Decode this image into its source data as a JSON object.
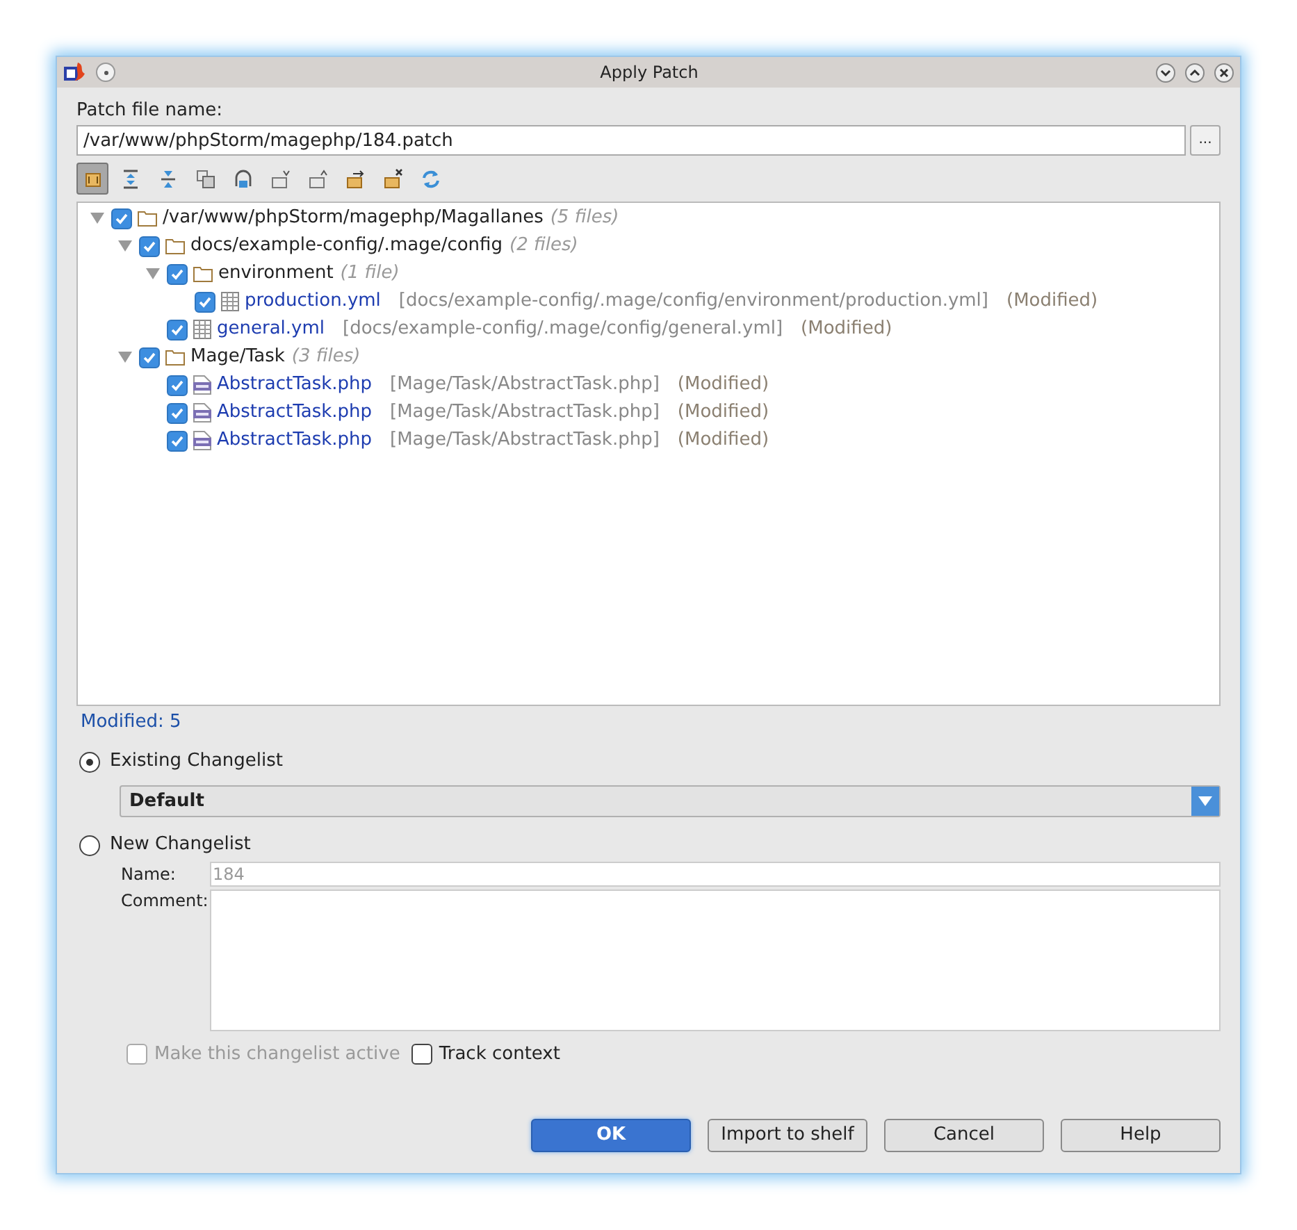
{
  "window": {
    "title": "Apply Patch"
  },
  "patch_file": {
    "label": "Patch file name:",
    "value": "/var/www/phpStorm/magephp/184.patch",
    "browse_label": "..."
  },
  "toolbar": [
    {
      "kind": "group",
      "selected": true
    },
    {
      "kind": "expand",
      "selected": false
    },
    {
      "kind": "collapse",
      "selected": false
    },
    {
      "kind": "copy",
      "selected": false
    },
    {
      "kind": "strip",
      "selected": false
    },
    {
      "kind": "down",
      "selected": false
    },
    {
      "kind": "up",
      "selected": false
    },
    {
      "kind": "export",
      "selected": false
    },
    {
      "kind": "remove",
      "selected": false
    },
    {
      "kind": "refresh",
      "selected": false
    }
  ],
  "tree": [
    {
      "kind": "folder",
      "name": "/var/www/phpStorm/magephp/Magallanes",
      "count": "(5 files)",
      "checked": true,
      "expanded": true,
      "children": [
        {
          "kind": "folder",
          "name": "docs/example-config/.mage/config",
          "count": "(2 files)",
          "checked": true,
          "expanded": true,
          "children": [
            {
              "kind": "folder",
              "name": "environment",
              "count": "(1 file)",
              "checked": true,
              "expanded": true,
              "children": [
                {
                  "kind": "yml",
                  "name": "production.yml",
                  "path": "[docs/example-config/.mage/config/environment/production.yml]",
                  "status": "(Modified)",
                  "checked": true
                }
              ]
            },
            {
              "kind": "yml",
              "name": "general.yml",
              "path": "[docs/example-config/.mage/config/general.yml]",
              "status": "(Modified)",
              "checked": true
            }
          ]
        },
        {
          "kind": "folder",
          "name": "Mage/Task",
          "count": "(3 files)",
          "checked": true,
          "expanded": true,
          "children": [
            {
              "kind": "php",
              "name": "AbstractTask.php",
              "path": "[Mage/Task/AbstractTask.php]",
              "status": "(Modified)",
              "checked": true
            },
            {
              "kind": "php",
              "name": "AbstractTask.php",
              "path": "[Mage/Task/AbstractTask.php]",
              "status": "(Modified)",
              "checked": true
            },
            {
              "kind": "php",
              "name": "AbstractTask.php",
              "path": "[Mage/Task/AbstractTask.php]",
              "status": "(Modified)",
              "checked": true
            }
          ]
        }
      ]
    }
  ],
  "summary": "Modified: 5",
  "changelist_options": [
    {
      "label": "Existing Changelist",
      "selected": true
    },
    {
      "label": "New Changelist",
      "selected": false
    }
  ],
  "existing_changelist": {
    "value": "Default"
  },
  "new_changelist": {
    "name_label": "Name:",
    "name_value": "184",
    "comment_label": "Comment:",
    "disabled": true
  },
  "checkboxes": [
    {
      "label": "Make this changelist active",
      "checked": false,
      "disabled": true
    },
    {
      "label": "Track context",
      "checked": false,
      "disabled": false
    }
  ],
  "buttons": [
    {
      "label": "OK",
      "selected": true
    },
    {
      "label": "Import to shelf",
      "selected": false
    },
    {
      "label": "Cancel",
      "selected": false
    },
    {
      "label": "Help",
      "selected": false
    }
  ]
}
